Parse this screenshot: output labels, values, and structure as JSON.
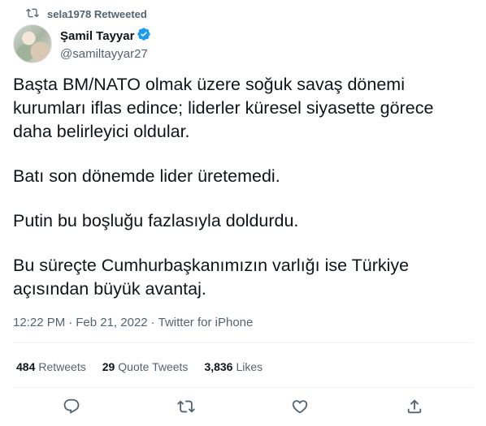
{
  "retweet_banner": {
    "text": "sela1978 Retweeted",
    "icon": "retweet-icon"
  },
  "author": {
    "display_name": "Şamil Tayyar",
    "handle": "@samiltayyar27",
    "verified": true,
    "verified_color": "#1d9bf0"
  },
  "tweet": {
    "paragraphs": [
      "Başta BM/NATO olmak üzere soğuk savaş dönemi kurumları iflas edince; liderler küresel siyasette görece daha belirleyici oldular.",
      "Batı son dönemde lider üretemedi.",
      "Putin bu boşluğu fazlasıyla doldurdu.",
      "Bu süreçte Cumhurbaşkanımızın varlığı ise Türkiye açısından büyük avantaj."
    ]
  },
  "meta": {
    "time": "12:22 PM",
    "separator": "·",
    "date": "Feb 21, 2022",
    "source": "Twitter for iPhone"
  },
  "stats": [
    {
      "count": "484",
      "label": "Retweets"
    },
    {
      "count": "29",
      "label": "Quote Tweets"
    },
    {
      "count": "3,836",
      "label": "Likes"
    }
  ],
  "actions": [
    {
      "name": "reply",
      "icon": "reply-icon"
    },
    {
      "name": "retweet",
      "icon": "retweet-icon"
    },
    {
      "name": "like",
      "icon": "heart-icon"
    },
    {
      "name": "share",
      "icon": "share-icon"
    }
  ],
  "colors": {
    "text": "#0f1419",
    "secondary": "#536471",
    "divider": "#eff3f4"
  }
}
